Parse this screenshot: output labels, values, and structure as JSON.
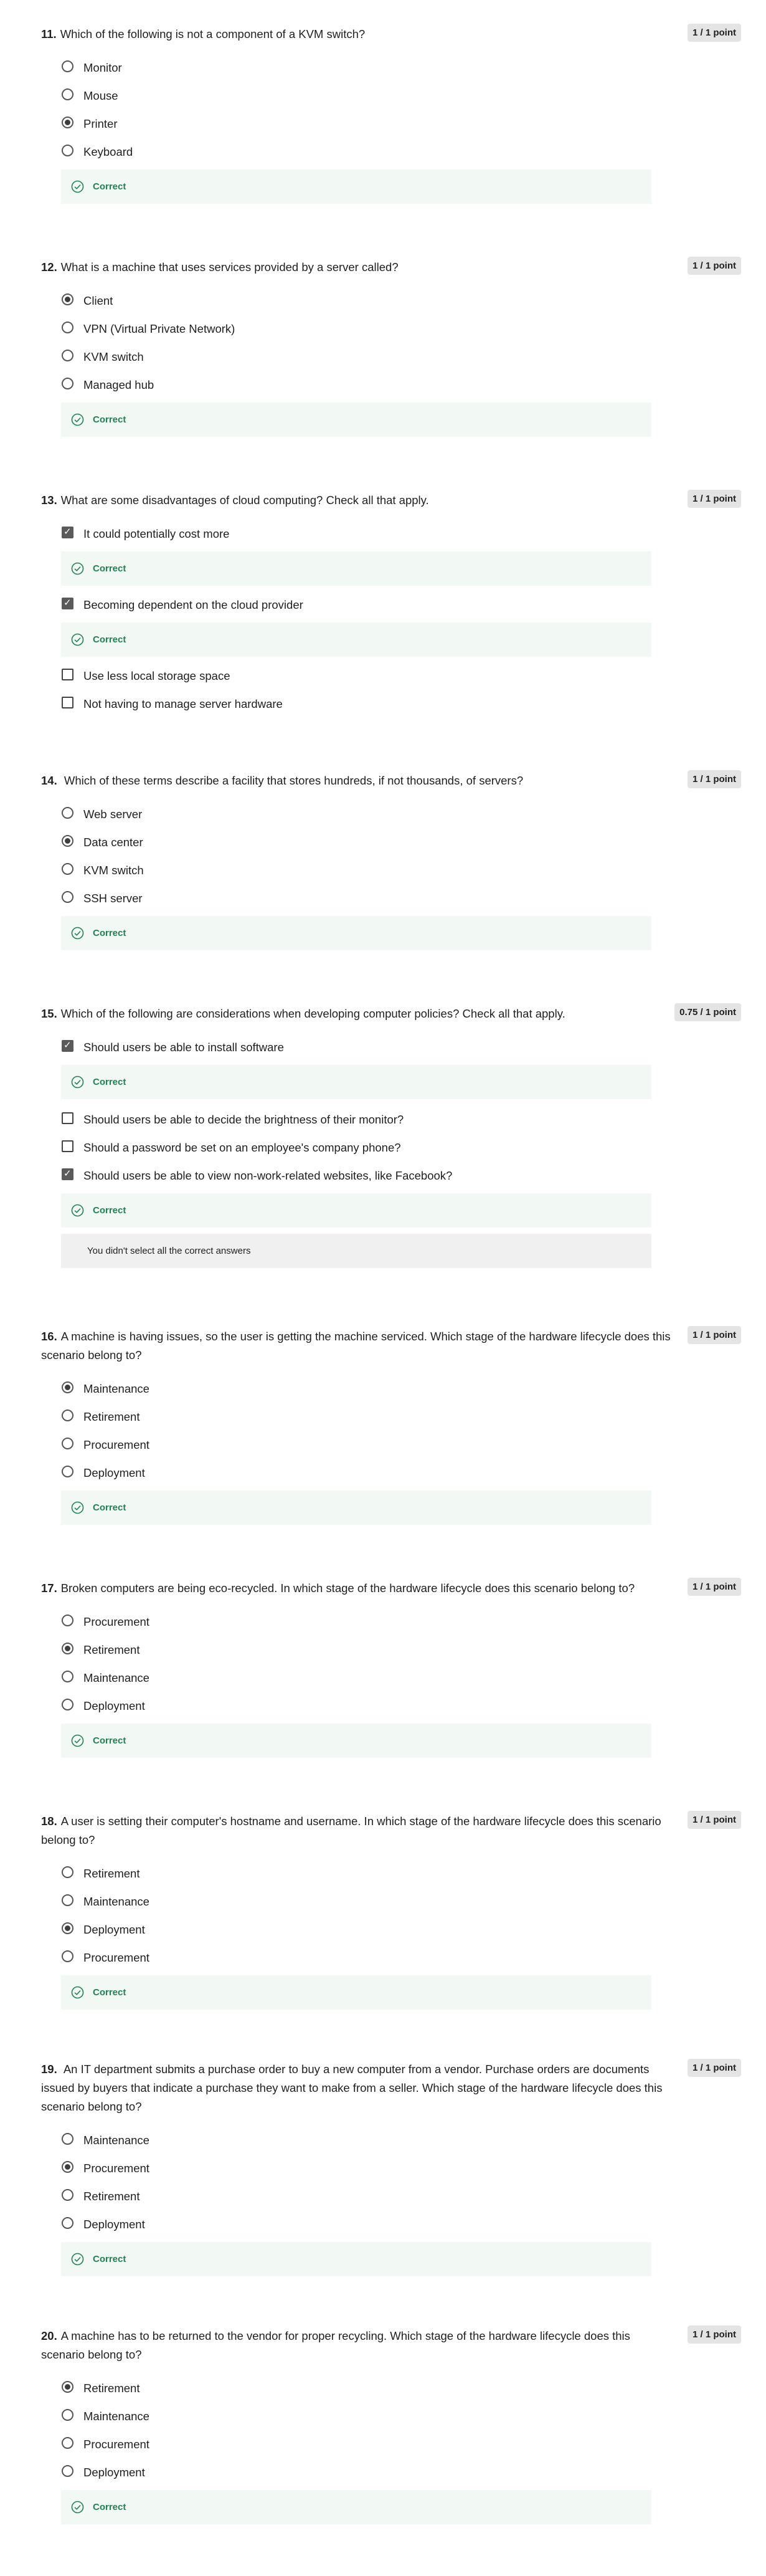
{
  "feedback_label": "Correct",
  "questions": [
    {
      "num": "11.",
      "text": "Which of the following is not a component of a KVM switch?",
      "score": "1 / 1 point",
      "options": [
        "Monitor",
        "Mouse",
        "Printer",
        "Keyboard"
      ]
    },
    {
      "num": "12.",
      "text": "What is a machine that uses services provided by a server called?",
      "score": "1 / 1 point",
      "options": [
        "Client",
        "VPN (Virtual Private Network)",
        "KVM switch",
        "Managed hub"
      ]
    },
    {
      "num": "13.",
      "text": "What are some disadvantages of cloud computing? Check all that apply.",
      "score": "1 / 1 point",
      "options": [
        "It could potentially cost more",
        "Becoming dependent on the cloud provider",
        "Use less local storage space",
        "Not having to manage server hardware"
      ]
    },
    {
      "num": "14.",
      "text": " Which of these terms describe a facility that stores hundreds, if not thousands, of servers?",
      "score": "1 / 1 point",
      "options": [
        "Web server",
        "Data center",
        "KVM switch",
        "SSH server"
      ]
    },
    {
      "num": "15.",
      "text": "Which of the following are considerations when developing computer policies? Check all that apply.",
      "score": "0.75 / 1 point",
      "options": [
        "Should users be able to install software",
        "Should users be able to decide the brightness of their monitor?",
        "Should a password be set on an employee's company phone?",
        "Should users be able to view non-work-related websites, like Facebook?"
      ],
      "warning": "You didn't select all the correct answers"
    },
    {
      "num": "16.",
      "text": "A machine is having issues, so the user is getting the machine serviced. Which stage of the hardware lifecycle does this scenario belong to?",
      "score": "1 / 1 point",
      "options": [
        "Maintenance",
        "Retirement",
        "Procurement",
        "Deployment"
      ]
    },
    {
      "num": "17.",
      "text": "Broken computers are being eco-recycled. In which stage of the hardware lifecycle does this scenario belong to?",
      "score": "1 / 1 point",
      "options": [
        "Procurement",
        "Retirement",
        "Maintenance",
        "Deployment"
      ]
    },
    {
      "num": "18.",
      "text": "A user is setting their computer's hostname and username. In which stage of the hardware lifecycle does this scenario belong to?",
      "score": "1 / 1 point",
      "options": [
        "Retirement",
        "Maintenance",
        "Deployment",
        "Procurement"
      ]
    },
    {
      "num": "19.",
      "text": " An IT department submits a purchase order to buy a new computer from a vendor. Purchase orders are documents issued by buyers that indicate a purchase they want to make from a seller. Which stage of the hardware lifecycle does this scenario belong to?",
      "score": "1 / 1 point",
      "options": [
        "Maintenance",
        "Procurement",
        "Retirement",
        "Deployment"
      ]
    },
    {
      "num": "20.",
      "text": "A machine has to be returned to the vendor for proper recycling. Which stage of the hardware lifecycle does this scenario belong to?",
      "score": "1 / 1 point",
      "options": [
        "Retirement",
        "Maintenance",
        "Procurement",
        "Deployment"
      ]
    }
  ],
  "colors": {
    "correct": "#1f8354",
    "feedback_bg": "#f2f8f4",
    "badge_bg": "#e4e4e4"
  }
}
